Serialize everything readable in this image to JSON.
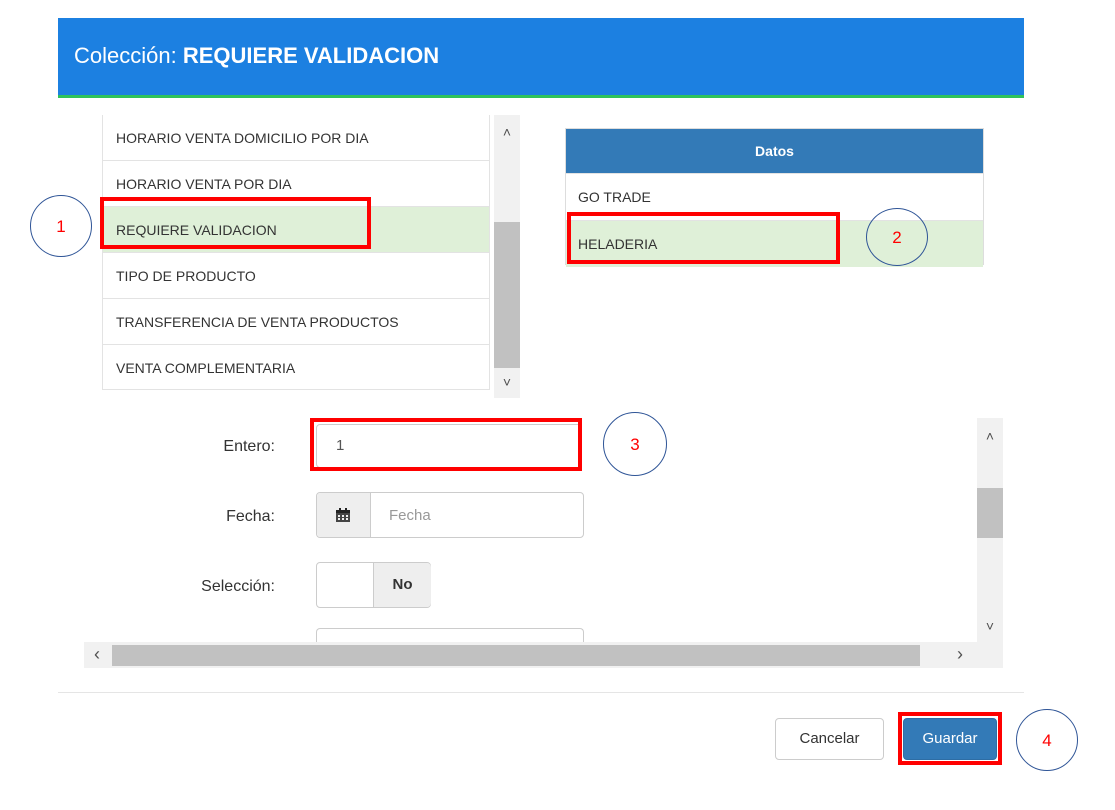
{
  "header": {
    "prefix": "Colección:",
    "title": "REQUIERE VALIDACION"
  },
  "collection_list": {
    "items": [
      {
        "label": "HORARIO VENTA DOMICILIO POR DIA",
        "selected": false
      },
      {
        "label": "HORARIO VENTA POR DIA",
        "selected": false
      },
      {
        "label": "REQUIERE VALIDACION",
        "selected": true
      },
      {
        "label": "TIPO DE PRODUCTO",
        "selected": false
      },
      {
        "label": "TRANSFERENCIA DE VENTA PRODUCTOS",
        "selected": false
      },
      {
        "label": "VENTA COMPLEMENTARIA",
        "selected": false
      }
    ]
  },
  "datos_table": {
    "header": "Datos",
    "rows": [
      {
        "label": "GO TRADE",
        "selected": false
      },
      {
        "label": "HELADERIA",
        "selected": true
      }
    ]
  },
  "form": {
    "entero_label": "Entero:",
    "entero_value": "1",
    "fecha_label": "Fecha:",
    "fecha_placeholder": "Fecha",
    "seleccion_label": "Selección:",
    "seleccion_value": "No"
  },
  "footer": {
    "cancel_label": "Cancelar",
    "save_label": "Guardar"
  },
  "annotations": [
    "1",
    "2",
    "3",
    "4"
  ],
  "icons": {
    "calendar": "calendar-icon",
    "scroll_up": "chevron-up-icon",
    "scroll_down": "chevron-down-icon",
    "scroll_left": "chevron-left-icon",
    "scroll_right": "chevron-right-icon"
  },
  "colors": {
    "header_bg": "#1c80e1",
    "header_border": "#2fc25b",
    "selected_row": "#dff0d8",
    "table_header": "#337ab7",
    "primary_button": "#337ab7",
    "annotation_red": "#ff0000"
  }
}
